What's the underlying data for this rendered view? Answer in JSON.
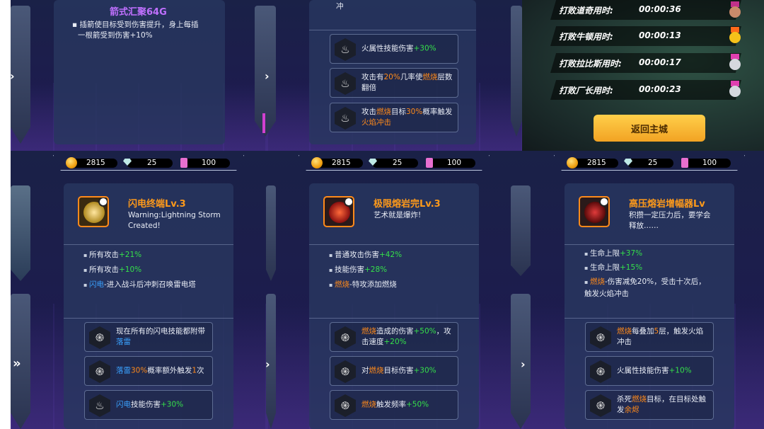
{
  "top_left": {
    "title": "箭式汇聚64G",
    "desc_line1": "▪ 插箭使目标受到伤害提升，身上每插",
    "desc_line2": "一根箭受到伤害+10%"
  },
  "top_mid": {
    "fragment": "冲",
    "perks": [
      {
        "parts": [
          [
            "",
            "火属性技能伤害"
          ],
          [
            "g",
            "+30%"
          ]
        ]
      },
      {
        "parts": [
          [
            "",
            "攻击有"
          ],
          [
            "o",
            "20%"
          ],
          [
            "",
            "几率使"
          ],
          [
            "o",
            "燃烧"
          ],
          [
            "",
            "层数翻倍"
          ]
        ]
      },
      {
        "parts": [
          [
            "",
            "攻击"
          ],
          [
            "o",
            "燃烧"
          ],
          [
            "",
            "目标"
          ],
          [
            "o",
            "30%"
          ],
          [
            "",
            "概率触发"
          ],
          [
            "o",
            "火焰冲击"
          ]
        ]
      }
    ]
  },
  "records": {
    "rows": [
      {
        "label": "打败道奇用时:",
        "time": "00:00:36",
        "medal": "bronze"
      },
      {
        "label": "打败牛顿用时:",
        "time": "00:00:13",
        "medal": "gold"
      },
      {
        "label": "打败拉比斯用时:",
        "time": "00:00:17",
        "medal": "silver"
      },
      {
        "label": "打败厂长用时:",
        "time": "00:00:23",
        "medal": "silver"
      }
    ],
    "return_button": "返回主城"
  },
  "resources": {
    "coins": "2815",
    "gems": "25",
    "ingots": "100"
  },
  "cards": [
    {
      "title": "闪电终端Lv.3",
      "subtitle_line1": "Warning:Lightning Storm",
      "subtitle_line2": "Created!",
      "bullets": [
        [
          [
            "",
            "所有攻击"
          ],
          [
            "g",
            "+21%"
          ]
        ],
        [
          [
            "",
            "所有攻击"
          ],
          [
            "g",
            "+10%"
          ]
        ],
        [
          [
            "b",
            "闪电"
          ],
          [
            "",
            "-进入战斗后冲刺召唤雷电塔"
          ]
        ]
      ],
      "perks": [
        [
          [
            "",
            "现在所有的闪电技能都附带"
          ],
          [
            "b",
            "落雷"
          ]
        ],
        [
          [
            "b",
            "落雷"
          ],
          [
            "o",
            "30%"
          ],
          [
            "",
            "概率额外触发"
          ],
          [
            "o",
            "1"
          ],
          [
            "",
            "次"
          ]
        ],
        [
          [
            "b",
            "闪电"
          ],
          [
            "",
            "技能伤害"
          ],
          [
            "g",
            "+30%"
          ]
        ]
      ]
    },
    {
      "title": "极限熔岩完Lv.3",
      "subtitle_line1": "艺术就是爆炸!",
      "subtitle_line2": "",
      "bullets": [
        [
          [
            "",
            "普通攻击伤害"
          ],
          [
            "g",
            "+42%"
          ]
        ],
        [
          [
            "",
            "技能伤害"
          ],
          [
            "g",
            "+28%"
          ]
        ],
        [
          [
            "o",
            "燃烧"
          ],
          [
            "",
            "-特攻添加燃烧"
          ]
        ]
      ],
      "perks": [
        [
          [
            "o",
            "燃烧"
          ],
          [
            "",
            "造成的伤害"
          ],
          [
            "g",
            "+50%"
          ],
          [
            "",
            "，攻击速度"
          ],
          [
            "g",
            "+20%"
          ]
        ],
        [
          [
            "",
            "对"
          ],
          [
            "o",
            "燃烧"
          ],
          [
            "",
            "目标伤害"
          ],
          [
            "g",
            "+30%"
          ]
        ],
        [
          [
            "o",
            "燃烧"
          ],
          [
            "",
            "触发频率"
          ],
          [
            "g",
            "+50%"
          ]
        ]
      ]
    },
    {
      "title": "高压熔岩增幅器Lv",
      "subtitle_line1": "积攒一定压力后，要学会",
      "subtitle_line2": "释放……",
      "bullets": [
        [
          [
            "",
            "生命上限"
          ],
          [
            "g",
            "+37%"
          ]
        ],
        [
          [
            "",
            "生命上限"
          ],
          [
            "g",
            "+15%"
          ]
        ],
        [
          [
            "o",
            "燃烧"
          ],
          [
            "",
            "-伤害减免20%，受击十次后，触发火焰冲击"
          ]
        ]
      ],
      "perks": [
        [
          [
            "o",
            "燃烧"
          ],
          [
            "",
            "每叠加"
          ],
          [
            "o",
            "5"
          ],
          [
            "",
            "层，触发火焰冲击"
          ]
        ],
        [
          [
            "",
            "火属性技能伤害"
          ],
          [
            "g",
            "+10%"
          ]
        ],
        [
          [
            "",
            "杀死"
          ],
          [
            "o",
            "燃烧"
          ],
          [
            "",
            "目标，在目标处触发"
          ],
          [
            "o",
            "余烬"
          ]
        ]
      ]
    }
  ],
  "colors": {
    "accent_orange": "#ff8a1a",
    "green": "#35e04a",
    "blue": "#3aa2ff",
    "gold_button": "#f2a323"
  }
}
